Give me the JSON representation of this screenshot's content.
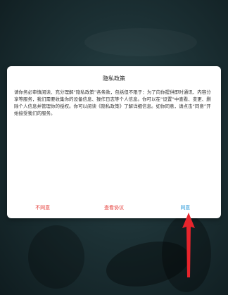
{
  "dialog": {
    "title": "隐私政策",
    "body": "请你务必审慎阅读、充分理解“隐私政策”各条款，包括但不限于：为了向你提供即时通讯、内容分享等服务，我们需要收集你的设备信息、操作日志等个人信息。你可以在“设置”中查看、变更、删除个人信息并管理你的授权。你可以阅读《隐私政策》了解详细信息。如你同意，请点击“同意”开始接受我们的服务。",
    "buttons": {
      "disagree": "不同意",
      "view_policy": "查看协议",
      "agree": "同意"
    }
  },
  "colors": {
    "disagree": "#e53935",
    "view_policy": "#e53935",
    "agree": "#2196d9",
    "annotation_arrow": "#e8242c"
  },
  "icons": {
    "annotation": "red-arrow-up-icon"
  }
}
